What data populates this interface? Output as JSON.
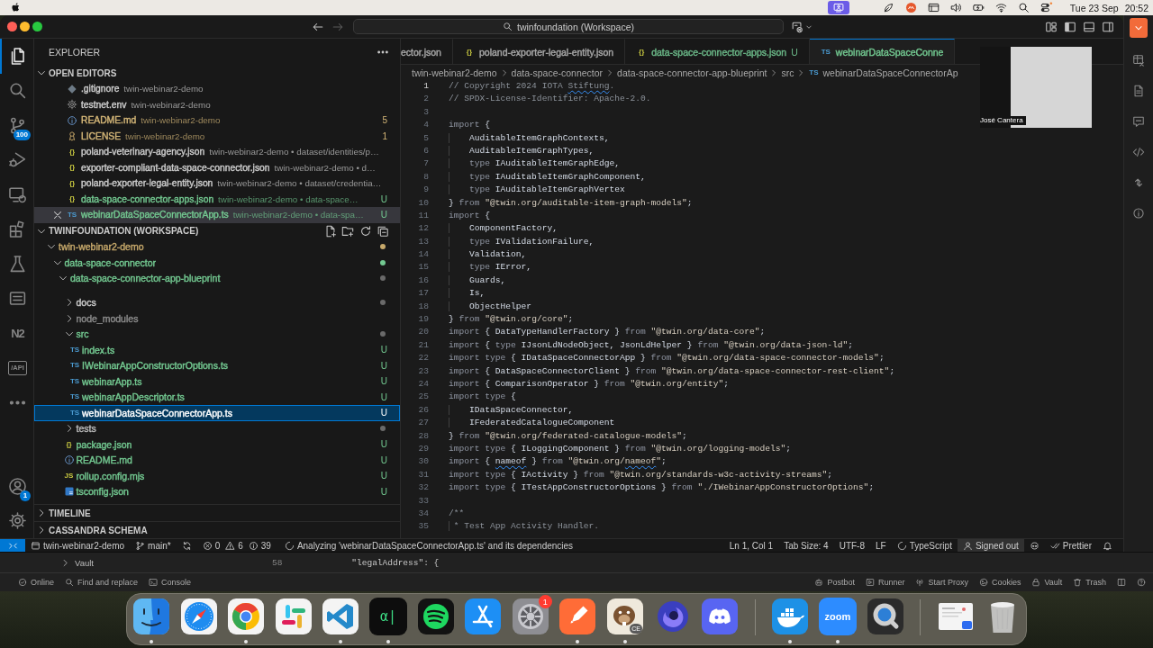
{
  "menu_bar": {
    "status_icons": [
      {
        "kind": "screen-share",
        "highlighted": true,
        "alert": false
      },
      {
        "kind": "leaf",
        "highlighted": false,
        "alert": false
      },
      {
        "kind": "record",
        "highlighted": false,
        "alert": false
      },
      {
        "kind": "window",
        "highlighted": false,
        "alert": false
      },
      {
        "kind": "volume",
        "highlighted": false,
        "alert": false
      },
      {
        "kind": "battery",
        "highlighted": false,
        "alert": false
      },
      {
        "kind": "wifi",
        "highlighted": false,
        "alert": false
      },
      {
        "kind": "search",
        "highlighted": false,
        "alert": false
      },
      {
        "kind": "control-center",
        "highlighted": false,
        "alert": true
      }
    ],
    "date": "Tue 23 Sep",
    "time": "20:52"
  },
  "window": {
    "title": "twinfoundation (Workspace)",
    "nav": [
      {
        "kind": "back",
        "disabled": false
      },
      {
        "kind": "forward",
        "disabled": true
      }
    ],
    "layout_controls": [
      {
        "kind": "customize"
      },
      {
        "kind": "primary-sidebar"
      },
      {
        "kind": "panel"
      },
      {
        "kind": "secondary-sidebar"
      }
    ]
  },
  "activity_bar": {
    "top": [
      {
        "kind": "explorer",
        "selected": true
      },
      {
        "kind": "search",
        "selected": false
      },
      {
        "kind": "source-control",
        "selected": false,
        "badge": "100"
      },
      {
        "kind": "run-debug",
        "selected": false
      },
      {
        "kind": "remote-explorer",
        "selected": false
      },
      {
        "kind": "extensions",
        "selected": false
      },
      {
        "kind": "testing",
        "selected": false
      },
      {
        "kind": "list-view",
        "selected": false
      },
      {
        "kind": "n2",
        "glyph": "N2",
        "selected": false
      },
      {
        "kind": "api",
        "glyph": "/API",
        "selected": false
      },
      {
        "kind": "more",
        "selected": false
      }
    ],
    "bottom": [
      {
        "kind": "accounts",
        "selected": false,
        "badge": "1"
      },
      {
        "kind": "manage",
        "selected": false
      }
    ]
  },
  "explorer": {
    "title": "EXPLORER",
    "open_editors": {
      "title": "OPEN EDITORS",
      "expanded": true,
      "items": [
        {
          "kind": "git",
          "name": ".gitignore",
          "path": "twin-webinar2-demo",
          "color": "#cccccc",
          "selected": false
        },
        {
          "kind": "gear",
          "name": "testnet.env",
          "path": "twin-webinar2-demo",
          "color": "#cccccc",
          "selected": false
        },
        {
          "kind": "info",
          "name": "README.md",
          "path": "twin-webinar2-demo",
          "color": "#d5b778",
          "badge": "5",
          "selected": false
        },
        {
          "kind": "license",
          "name": "LICENSE",
          "path": "twin-webinar2-demo",
          "color": "#d5b778",
          "badge": "1",
          "selected": false
        },
        {
          "kind": "json",
          "glyph": "{}",
          "name": "poland-veterinary-agency.json",
          "path": "twin-webinar2-demo • dataset/identities/p…",
          "color": "#cccccc",
          "selected": false
        },
        {
          "kind": "json",
          "glyph": "{}",
          "name": "exporter-compliant-data-space-connector.json",
          "path": "twin-webinar2-demo • d…",
          "color": "#cccccc",
          "selected": false
        },
        {
          "kind": "json",
          "glyph": "{}",
          "name": "poland-exporter-legal-entity.json",
          "path": "twin-webinar2-demo • dataset/credentia…",
          "color": "#cccccc",
          "selected": false
        },
        {
          "kind": "json",
          "glyph": "{}",
          "name": "data-space-connector-apps.json",
          "path": "twin-webinar2-demo • data-space…",
          "color": "#73c991",
          "badge": "U",
          "selected": false
        },
        {
          "kind": "ts",
          "glyph": "TS",
          "name": "webinarDataSpaceConnectorApp.ts",
          "path": "twin-webinar2-demo • data-spa…",
          "color": "#73c991",
          "badge": "U",
          "selected": true
        }
      ]
    },
    "workspace": {
      "title": "TWINFOUNDATION (WORKSPACE)",
      "expanded": true,
      "actions": [
        {
          "kind": "new-file"
        },
        {
          "kind": "new-folder"
        },
        {
          "kind": "refresh"
        },
        {
          "kind": "collapse"
        }
      ],
      "tree": [
        {
          "kind": "folder",
          "label": "twin-webinar2-demo",
          "color": "#c7a96b",
          "dot": {
            "color": "#c7a96b"
          },
          "expanded": true,
          "selected": false,
          "children": [
            {
              "kind": "folder",
              "label": "data-space-connector",
              "color": "#73c991",
              "dot": {
                "color": "#73c991"
              },
              "expanded": true,
              "selected": false,
              "children": [
                {
                  "kind": "folder",
                  "label": "data-space-connector-app-blueprint",
                  "color": "#73c991",
                  "dot": {
                    "color": "#6a6a6a"
                  },
                  "expanded": true,
                  "selected": false,
                  "children": [
                    {
                      "kind": "folder",
                      "label": "docs",
                      "color": "#cccccc",
                      "dot": {
                        "color": "#6a6a6a"
                      },
                      "expanded": false,
                      "selected": false
                    },
                    {
                      "kind": "folder",
                      "label": "node_modules",
                      "color": "#8c8c8c",
                      "expanded": false,
                      "selected": false
                    },
                    {
                      "kind": "folder",
                      "label": "src",
                      "color": "#73c991",
                      "dot": {
                        "color": "#6a6a6a"
                      },
                      "expanded": true,
                      "selected": false,
                      "children": [
                        {
                          "kind": "ts",
                          "glyph": "TS",
                          "label": "index.ts",
                          "color": "#73c991",
                          "badge": "U",
                          "selected": false
                        },
                        {
                          "kind": "ts",
                          "glyph": "TS",
                          "label": "IWebinarAppConstructorOptions.ts",
                          "color": "#73c991",
                          "badge": "U",
                          "selected": false
                        },
                        {
                          "kind": "ts",
                          "glyph": "TS",
                          "label": "webinarApp.ts",
                          "color": "#73c991",
                          "badge": "U",
                          "selected": false
                        },
                        {
                          "kind": "ts",
                          "glyph": "TS",
                          "label": "webinarAppDescriptor.ts",
                          "color": "#73c991",
                          "badge": "U",
                          "selected": false
                        },
                        {
                          "kind": "ts",
                          "glyph": "TS",
                          "label": "webinarDataSpaceConnectorApp.ts",
                          "color": "#ffffff",
                          "badge": "U",
                          "selected": true
                        }
                      ]
                    },
                    {
                      "kind": "folder",
                      "label": "tests",
                      "color": "#bbbbbb",
                      "dot": {
                        "color": "#6a6a6a"
                      },
                      "expanded": false,
                      "selected": false
                    },
                    {
                      "kind": "json",
                      "glyph": "{}",
                      "label": "package.json",
                      "color": "#73c991",
                      "badge": "U",
                      "selected": false
                    },
                    {
                      "kind": "info",
                      "label": "README.md",
                      "color": "#73c991",
                      "badge": "U",
                      "selected": false
                    },
                    {
                      "kind": "js",
                      "glyph": "JS",
                      "label": "rollup.config.mjs",
                      "color": "#73c991",
                      "badge": "U",
                      "selected": false
                    },
                    {
                      "kind": "tsconfig",
                      "label": "tsconfig.json",
                      "color": "#73c991",
                      "badge": "U",
                      "selected": false
                    }
                  ]
                }
              ]
            }
          ]
        }
      ]
    },
    "sections": [
      {
        "title": "TIMELINE",
        "expanded": false
      },
      {
        "title": "CASSANDRA SCHEMA",
        "expanded": false
      }
    ]
  },
  "editor": {
    "tabs": [
      {
        "label": "ector.json",
        "color": "#a8a8a8",
        "selected": false
      },
      {
        "kind": "json",
        "glyph": "{}",
        "label": "poland-exporter-legal-entity.json",
        "color": "#a8a8a8",
        "selected": false
      },
      {
        "kind": "json",
        "glyph": "{}",
        "label": "data-space-connector-apps.json",
        "color": "#6bb888",
        "badge": "U",
        "selected": false
      },
      {
        "kind": "ts",
        "glyph": "TS",
        "label": "webinarDataSpaceConne",
        "color": "#73c991",
        "selected": true
      }
    ],
    "breadcrumbs": [
      {
        "label": "twin-webinar2-demo"
      },
      {
        "label": "data-space-connector"
      },
      {
        "label": "data-space-connector-app-blueprint"
      },
      {
        "label": "src"
      },
      {
        "kind": "ts",
        "glyph": "TS",
        "label": "webinarDataSpaceConnectorAp"
      }
    ],
    "lines": [
      {
        "number": "1",
        "current": true,
        "tokens": [
          {
            "kind": "cm",
            "text": "// Copyright 2024 IOTA "
          },
          {
            "kind": "cm-flag",
            "text": "Stiftung"
          },
          {
            "kind": "cm",
            "text": "."
          }
        ]
      },
      {
        "number": "2",
        "current": false,
        "tokens": [
          {
            "kind": "cm",
            "text": "// SPDX-License-Identifier: Apache-2.0."
          }
        ]
      },
      {
        "number": "3",
        "current": false
      },
      {
        "number": "4",
        "current": false,
        "tokens": [
          {
            "kind": "kw",
            "text": "import"
          },
          {
            "kind": "id",
            "text": " {"
          }
        ]
      },
      {
        "number": "5",
        "current": false,
        "tokens": [
          {
            "kind": "id",
            "text": "    AuditableItemGraphContexts,"
          }
        ]
      },
      {
        "number": "6",
        "current": false,
        "tokens": [
          {
            "kind": "id",
            "text": "    AuditableItemGraphTypes,"
          }
        ]
      },
      {
        "number": "7",
        "current": false,
        "tokens": [
          {
            "kind": "kw",
            "text": "    type"
          },
          {
            "kind": "id",
            "text": " IAuditableItemGraphEdge,"
          }
        ]
      },
      {
        "number": "8",
        "current": false,
        "tokens": [
          {
            "kind": "kw",
            "text": "    type"
          },
          {
            "kind": "id",
            "text": " IAuditableItemGraphComponent,"
          }
        ]
      },
      {
        "number": "9",
        "current": false,
        "tokens": [
          {
            "kind": "kw",
            "text": "    type"
          },
          {
            "kind": "id",
            "text": " IAuditableItemGraphVertex"
          }
        ]
      },
      {
        "number": "10",
        "current": false,
        "tokens": [
          {
            "kind": "id",
            "text": "} "
          },
          {
            "kind": "kw",
            "text": "from "
          },
          {
            "kind": "str",
            "text": "\"@twin.org/auditable-item-graph-models\""
          },
          {
            "kind": "id",
            "text": ";"
          }
        ]
      },
      {
        "number": "11",
        "current": false,
        "tokens": [
          {
            "kind": "kw",
            "text": "import"
          },
          {
            "kind": "id",
            "text": " {"
          }
        ]
      },
      {
        "number": "12",
        "current": false,
        "tokens": [
          {
            "kind": "id",
            "text": "    ComponentFactory,"
          }
        ]
      },
      {
        "number": "13",
        "current": false,
        "tokens": [
          {
            "kind": "kw",
            "text": "    type"
          },
          {
            "kind": "id",
            "text": " IValidationFailure,"
          }
        ]
      },
      {
        "number": "14",
        "current": false,
        "tokens": [
          {
            "kind": "id",
            "text": "    Validation,"
          }
        ]
      },
      {
        "number": "15",
        "current": false,
        "tokens": [
          {
            "kind": "kw",
            "text": "    type"
          },
          {
            "kind": "id",
            "text": " IError,"
          }
        ]
      },
      {
        "number": "16",
        "current": false,
        "tokens": [
          {
            "kind": "id",
            "text": "    Guards,"
          }
        ]
      },
      {
        "number": "17",
        "current": false,
        "tokens": [
          {
            "kind": "id",
            "text": "    Is,"
          }
        ]
      },
      {
        "number": "18",
        "current": false,
        "tokens": [
          {
            "kind": "id",
            "text": "    ObjectHelper"
          }
        ]
      },
      {
        "number": "19",
        "current": false,
        "tokens": [
          {
            "kind": "id",
            "text": "} "
          },
          {
            "kind": "kw",
            "text": "from "
          },
          {
            "kind": "str",
            "text": "\"@twin.org/core\""
          },
          {
            "kind": "id",
            "text": ";"
          }
        ]
      },
      {
        "number": "20",
        "current": false,
        "tokens": [
          {
            "kind": "kw",
            "text": "import"
          },
          {
            "kind": "id",
            "text": " { DataTypeHandlerFactory } "
          },
          {
            "kind": "kw",
            "text": "from "
          },
          {
            "kind": "str",
            "text": "\"@twin.org/data-core\""
          },
          {
            "kind": "id",
            "text": ";"
          }
        ]
      },
      {
        "number": "21",
        "current": false,
        "tokens": [
          {
            "kind": "kw",
            "text": "import"
          },
          {
            "kind": "id",
            "text": " { "
          },
          {
            "kind": "kw",
            "text": "type"
          },
          {
            "kind": "id",
            "text": " IJsonLdNodeObject, JsonLdHelper } "
          },
          {
            "kind": "kw",
            "text": "from "
          },
          {
            "kind": "str",
            "text": "\"@twin.org/data-json-ld\""
          },
          {
            "kind": "id",
            "text": ";"
          }
        ]
      },
      {
        "number": "22",
        "current": false,
        "tokens": [
          {
            "kind": "kw",
            "text": "import type"
          },
          {
            "kind": "id",
            "text": " { IDataSpaceConnectorApp } "
          },
          {
            "kind": "kw",
            "text": "from "
          },
          {
            "kind": "str",
            "text": "\"@twin.org/data-space-connector-models\""
          },
          {
            "kind": "id",
            "text": ";"
          }
        ]
      },
      {
        "number": "23",
        "current": false,
        "tokens": [
          {
            "kind": "kw",
            "text": "import"
          },
          {
            "kind": "id",
            "text": " { DataSpaceConnectorClient } "
          },
          {
            "kind": "kw",
            "text": "from "
          },
          {
            "kind": "str",
            "text": "\"@twin.org/data-space-connector-rest-client\""
          },
          {
            "kind": "id",
            "text": ";"
          }
        ]
      },
      {
        "number": "24",
        "current": false,
        "tokens": [
          {
            "kind": "kw",
            "text": "import"
          },
          {
            "kind": "id",
            "text": " { ComparisonOperator } "
          },
          {
            "kind": "kw",
            "text": "from "
          },
          {
            "kind": "str",
            "text": "\"@twin.org/entity\""
          },
          {
            "kind": "id",
            "text": ";"
          }
        ]
      },
      {
        "number": "25",
        "current": false,
        "tokens": [
          {
            "kind": "kw",
            "text": "import type"
          },
          {
            "kind": "id",
            "text": " {"
          }
        ]
      },
      {
        "number": "26",
        "current": false,
        "tokens": [
          {
            "kind": "id",
            "text": "    IDataSpaceConnector,"
          }
        ]
      },
      {
        "number": "27",
        "current": false,
        "tokens": [
          {
            "kind": "id",
            "text": "    IFederatedCatalogueComponent"
          }
        ]
      },
      {
        "number": "28",
        "current": false,
        "tokens": [
          {
            "kind": "id",
            "text": "} "
          },
          {
            "kind": "kw",
            "text": "from "
          },
          {
            "kind": "str",
            "text": "\"@twin.org/federated-catalogue-models\""
          },
          {
            "kind": "id",
            "text": ";"
          }
        ]
      },
      {
        "number": "29",
        "current": false,
        "tokens": [
          {
            "kind": "kw",
            "text": "import type"
          },
          {
            "kind": "id",
            "text": " { ILoggingComponent } "
          },
          {
            "kind": "kw",
            "text": "from "
          },
          {
            "kind": "str",
            "text": "\"@twin.org/logging-models\""
          },
          {
            "kind": "id",
            "text": ";"
          }
        ]
      },
      {
        "number": "30",
        "current": false,
        "tokens": [
          {
            "kind": "kw",
            "text": "import"
          },
          {
            "kind": "id",
            "text": " { "
          },
          {
            "kind": "id-flag",
            "text": "nameof"
          },
          {
            "kind": "id",
            "text": " } "
          },
          {
            "kind": "kw",
            "text": "from "
          },
          {
            "kind": "str",
            "text": "\"@twin.org/"
          },
          {
            "kind": "str-flag",
            "text": "nameof"
          },
          {
            "kind": "str",
            "text": "\""
          },
          {
            "kind": "id",
            "text": ";"
          }
        ]
      },
      {
        "number": "31",
        "current": false,
        "tokens": [
          {
            "kind": "kw",
            "text": "import type"
          },
          {
            "kind": "id",
            "text": " { IActivity } "
          },
          {
            "kind": "kw",
            "text": "from "
          },
          {
            "kind": "str",
            "text": "\"@twin.org/standards-w3c-activity-streams\""
          },
          {
            "kind": "id",
            "text": ";"
          }
        ]
      },
      {
        "number": "32",
        "current": false,
        "tokens": [
          {
            "kind": "kw",
            "text": "import type"
          },
          {
            "kind": "id",
            "text": " { ITestAppConstructorOptions } "
          },
          {
            "kind": "kw",
            "text": "from "
          },
          {
            "kind": "str",
            "text": "\"./IWebinarAppConstructorOptions\""
          },
          {
            "kind": "id",
            "text": ";"
          }
        ]
      },
      {
        "number": "33",
        "current": false
      },
      {
        "number": "34",
        "current": false,
        "tokens": [
          {
            "kind": "cm",
            "text": "/**"
          }
        ]
      },
      {
        "number": "35",
        "current": false,
        "tokens": [
          {
            "kind": "cm",
            "text": " * Test App Activity Handler."
          }
        ]
      }
    ],
    "video_call": {
      "participant": "José Cantera"
    }
  },
  "status_bar": {
    "left": [
      {
        "kind": "remote"
      },
      {
        "kind": "workspace",
        "text": "twin-webinar2-demo"
      },
      {
        "kind": "branch",
        "text": "main*"
      },
      {
        "kind": "sync"
      },
      {
        "kind": "problems",
        "errors": "0",
        "warnings": "6",
        "infos": "39"
      },
      {
        "kind": "progress",
        "text": "Analyzing 'webinarDataSpaceConnectorApp.ts' and its dependencies"
      }
    ],
    "right": [
      {
        "kind": "text",
        "text": "Ln 1, Col 1"
      },
      {
        "kind": "text",
        "text": "Tab Size: 4"
      },
      {
        "kind": "text",
        "text": "UTF-8"
      },
      {
        "kind": "text",
        "text": "LF"
      },
      {
        "kind": "progress",
        "text": "TypeScript"
      },
      {
        "kind": "account",
        "text": "Signed out"
      },
      {
        "kind": "assistant"
      },
      {
        "kind": "formatter",
        "text": "Prettier"
      },
      {
        "kind": "notifications"
      }
    ]
  },
  "background_window": {
    "top_button": {
      "kind": "dropdown"
    },
    "side_icons": [
      {
        "kind": "table"
      },
      {
        "kind": "document"
      },
      {
        "kind": "message"
      },
      {
        "kind": "code"
      },
      {
        "kind": "swap"
      },
      {
        "kind": "info"
      }
    ],
    "tree_item": {
      "label": "Vault",
      "expanded": false
    },
    "line_number": "58",
    "code_line": "\"legalAddress\": {",
    "footer_left": [
      {
        "kind": "online",
        "label": "Online"
      },
      {
        "kind": "find",
        "label": "Find and replace"
      },
      {
        "kind": "console",
        "label": "Console"
      }
    ],
    "footer_right": [
      {
        "kind": "postbot",
        "label": "Postbot"
      },
      {
        "kind": "runner",
        "label": "Runner"
      },
      {
        "kind": "proxy",
        "label": "Start Proxy"
      },
      {
        "kind": "cookies",
        "label": "Cookies"
      },
      {
        "kind": "vault",
        "label": "Vault"
      },
      {
        "kind": "trash",
        "label": "Trash"
      },
      {
        "kind": "layout"
      },
      {
        "kind": "help"
      }
    ]
  },
  "dock": {
    "groups": [
      {
        "apps": [
          {
            "kind": "face",
            "running": true
          },
          {
            "kind": "compass",
            "running": false
          },
          {
            "kind": "segmented-circle",
            "running": true
          },
          {
            "kind": "hash",
            "running": false
          },
          {
            "kind": "ribbon",
            "running": true
          },
          {
            "kind": "mono-tile",
            "glyph": "α|",
            "running": true
          },
          {
            "kind": "waves",
            "running": false
          },
          {
            "kind": "a-strokes",
            "running": false
          },
          {
            "kind": "gear",
            "badge": "1",
            "running": false
          },
          {
            "kind": "pen",
            "running": true
          },
          {
            "kind": "beaver",
            "glyph": "CE",
            "running": true
          },
          {
            "kind": "swirl",
            "running": false
          },
          {
            "kind": "controller",
            "running": false
          }
        ]
      },
      {
        "apps": [
          {
            "kind": "whale",
            "running": true
          },
          {
            "kind": "label-tile",
            "glyph": "zoom",
            "running": true
          },
          {
            "kind": "lens",
            "running": false
          }
        ]
      },
      {
        "apps": [
          {
            "kind": "document",
            "running": false
          },
          {
            "kind": "trash",
            "running": false
          }
        ]
      }
    ]
  }
}
